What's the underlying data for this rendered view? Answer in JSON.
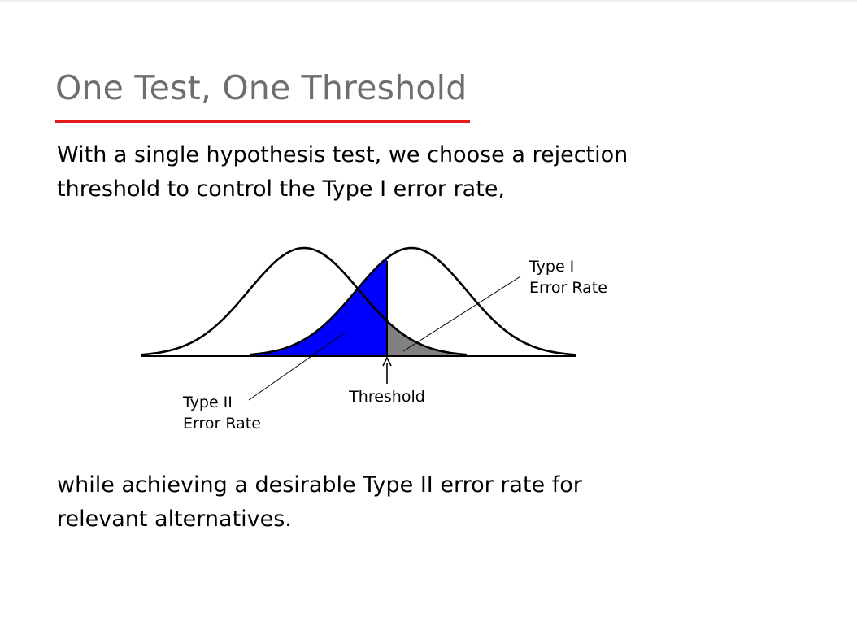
{
  "slide": {
    "title": "One Test, One Threshold",
    "intro_text": "With a single hypothesis test, we choose a rejection threshold to control the Type I error rate,",
    "outro_text": "while achieving a desirable Type II error rate for relevant alternatives."
  },
  "diagram": {
    "type1_label": [
      "Type I",
      "Error Rate"
    ],
    "type2_label": [
      "Type II",
      "Error Rate"
    ],
    "threshold_label": "Threshold",
    "colors": {
      "type2_region": "#0000ff",
      "type1_region": "#808080",
      "curves": "#000000",
      "title_underline": "#e31b1b",
      "title_text": "#6e6e6e"
    }
  }
}
